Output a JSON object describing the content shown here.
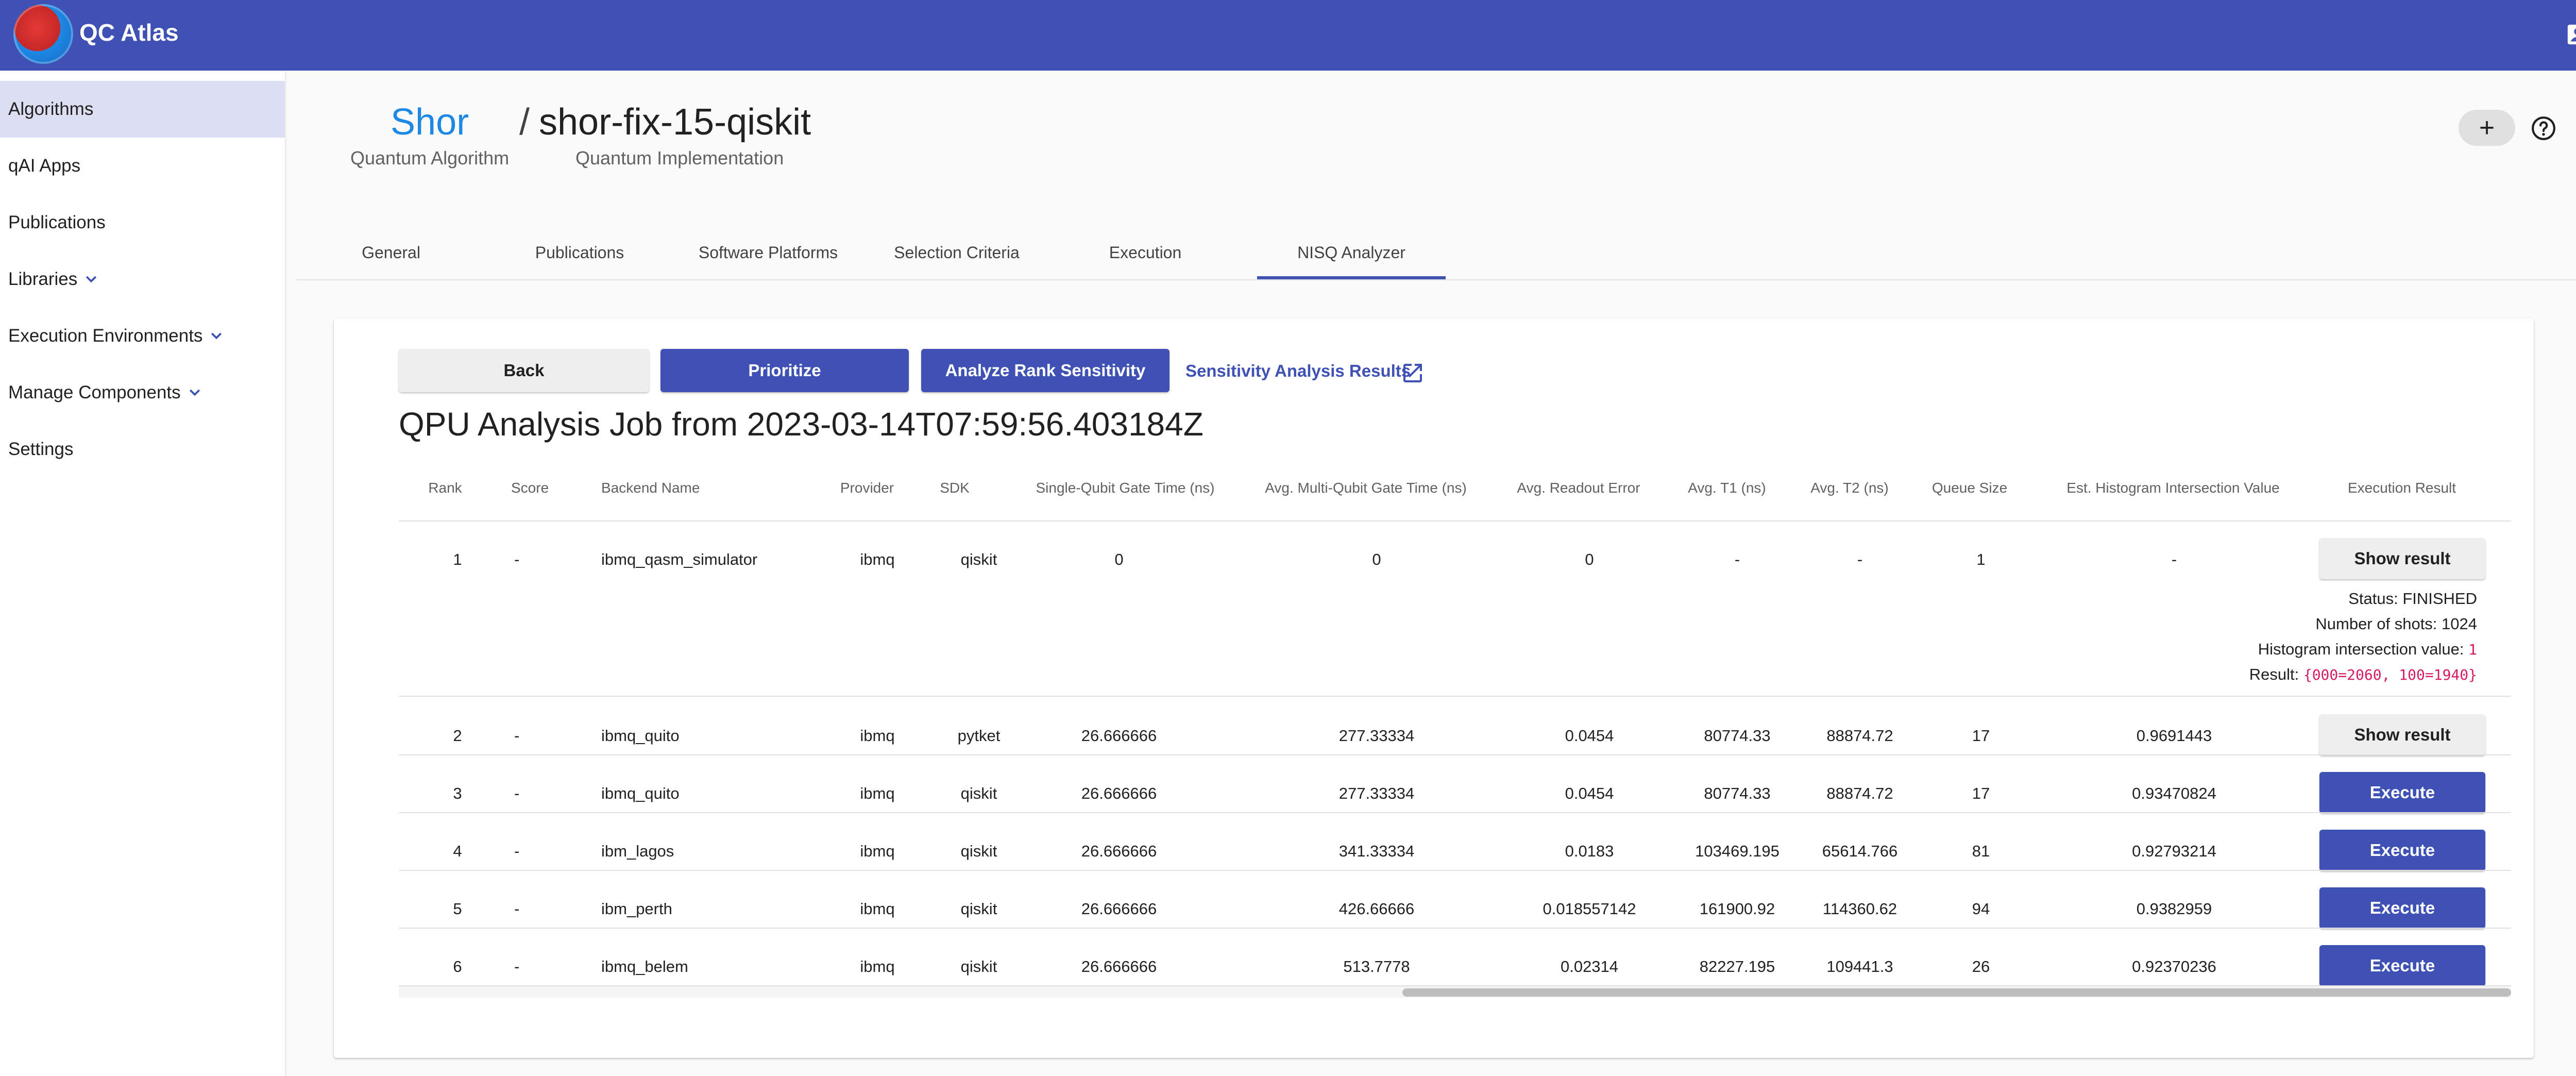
{
  "app": {
    "title": "QC Atlas"
  },
  "sidebar": {
    "items": [
      {
        "label": "Algorithms"
      },
      {
        "label": "qAI Apps"
      },
      {
        "label": "Publications"
      },
      {
        "label": "Libraries"
      },
      {
        "label": "Execution Environments"
      },
      {
        "label": "Manage Components"
      },
      {
        "label": "Settings"
      }
    ]
  },
  "header": {
    "algorithm": "Shor",
    "separator": "/",
    "implementation": "shor-fix-15-qiskit",
    "algorithm_caption": "Quantum Algorithm",
    "implementation_caption": "Quantum Implementation",
    "add_label": "+"
  },
  "tabs": [
    {
      "label": "General"
    },
    {
      "label": "Publications"
    },
    {
      "label": "Software Platforms"
    },
    {
      "label": "Selection Criteria"
    },
    {
      "label": "Execution"
    },
    {
      "label": "NISQ Analyzer",
      "active": true
    }
  ],
  "actions": {
    "back": "Back",
    "prioritize": "Prioritize",
    "analyze": "Analyze Rank Sensitivity",
    "results_link": "Sensitivity Analysis Results"
  },
  "job": {
    "title": "QPU Analysis Job from 2023-03-14T07:59:56.403184Z"
  },
  "table": {
    "headers": {
      "rank": "Rank",
      "score": "Score",
      "backend": "Backend Name",
      "provider": "Provider",
      "sdk": "SDK",
      "sq_time": "Single-Qubit Gate Time (ns)",
      "mq_time": "Avg. Multi-Qubit Gate Time (ns)",
      "readout": "Avg. Readout Error",
      "t1": "Avg. T1 (ns)",
      "t2": "Avg. T2 (ns)",
      "queue": "Queue Size",
      "hist": "Est. Histogram Intersection Value",
      "result": "Execution Result"
    },
    "rows": [
      {
        "rank": "1",
        "score": "-",
        "backend": "ibmq_qasm_simulator",
        "provider": "ibmq",
        "sdk": "qiskit",
        "sq_time": "0",
        "mq_time": "0",
        "readout": "0",
        "t1": "-",
        "t2": "-",
        "queue": "1",
        "hist": "-",
        "action": "Show result"
      },
      {
        "rank": "2",
        "score": "-",
        "backend": "ibmq_quito",
        "provider": "ibmq",
        "sdk": "pytket",
        "sq_time": "26.666666",
        "mq_time": "277.33334",
        "readout": "0.0454",
        "t1": "80774.33",
        "t2": "88874.72",
        "queue": "17",
        "hist": "0.9691443",
        "action": "Show result"
      },
      {
        "rank": "3",
        "score": "-",
        "backend": "ibmq_quito",
        "provider": "ibmq",
        "sdk": "qiskit",
        "sq_time": "26.666666",
        "mq_time": "277.33334",
        "readout": "0.0454",
        "t1": "80774.33",
        "t2": "88874.72",
        "queue": "17",
        "hist": "0.93470824",
        "action": "Execute"
      },
      {
        "rank": "4",
        "score": "-",
        "backend": "ibm_lagos",
        "provider": "ibmq",
        "sdk": "qiskit",
        "sq_time": "26.666666",
        "mq_time": "341.33334",
        "readout": "0.0183",
        "t1": "103469.195",
        "t2": "65614.766",
        "queue": "81",
        "hist": "0.92793214",
        "action": "Execute"
      },
      {
        "rank": "5",
        "score": "-",
        "backend": "ibm_perth",
        "provider": "ibmq",
        "sdk": "qiskit",
        "sq_time": "26.666666",
        "mq_time": "426.66666",
        "readout": "0.018557142",
        "t1": "161900.92",
        "t2": "114360.62",
        "queue": "94",
        "hist": "0.9382959",
        "action": "Execute"
      },
      {
        "rank": "6",
        "score": "-",
        "backend": "ibmq_belem",
        "provider": "ibmq",
        "sdk": "qiskit",
        "sq_time": "26.666666",
        "mq_time": "513.7778",
        "readout": "0.02314",
        "t1": "82227.195",
        "t2": "109441.3",
        "queue": "26",
        "hist": "0.92370236",
        "action": "Execute"
      }
    ],
    "detail": {
      "status": "Status: FINISHED",
      "shots": "Number of shots: 1024",
      "hist_label": "Histogram intersection value: ",
      "hist_value": "1",
      "result_label": "Result: ",
      "result_value": "{000=2060, 100=1940}"
    }
  },
  "colors": {
    "primary": "#3f51b5",
    "link": "#1e88e5",
    "code": "#d81b60"
  }
}
